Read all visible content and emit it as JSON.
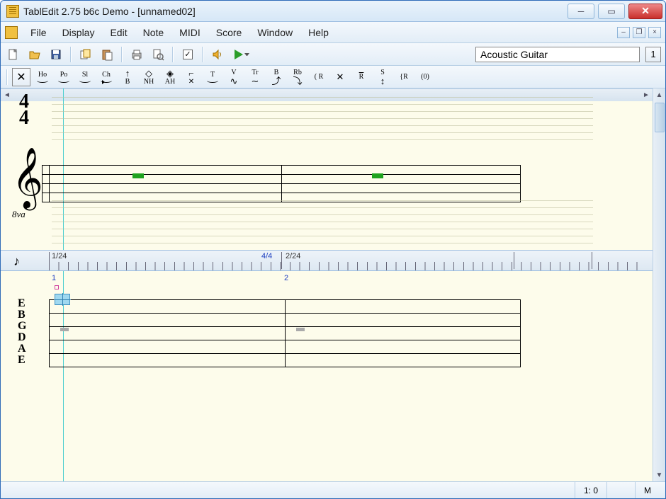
{
  "window": {
    "title": "TablEdit 2.75 b6c Demo - [unnamed02]"
  },
  "menu": {
    "items": [
      "File",
      "Display",
      "Edit",
      "Note",
      "MIDI",
      "Score",
      "Window",
      "Help"
    ]
  },
  "toolbar": {
    "instrument": "Acoustic Guitar",
    "track_num": "1"
  },
  "effects": {
    "labels": [
      "Ho",
      "Po",
      "Sl",
      "Ch",
      "B",
      "NH",
      "AH",
      "T",
      "V",
      "Tr",
      "B",
      "Rb",
      "R",
      "R",
      "S",
      "R",
      "(0)"
    ]
  },
  "score": {
    "time_sig_top": "4",
    "time_sig_bottom": "4",
    "ottava": "8va",
    "ruler": {
      "pos1": "1/24",
      "ts": "4/4",
      "pos2": "2/24"
    },
    "measures": [
      "1",
      "2"
    ],
    "tuning": [
      "E",
      "B",
      "G",
      "D",
      "A",
      "E"
    ]
  },
  "status": {
    "position": "1: 0",
    "mode": "M"
  }
}
